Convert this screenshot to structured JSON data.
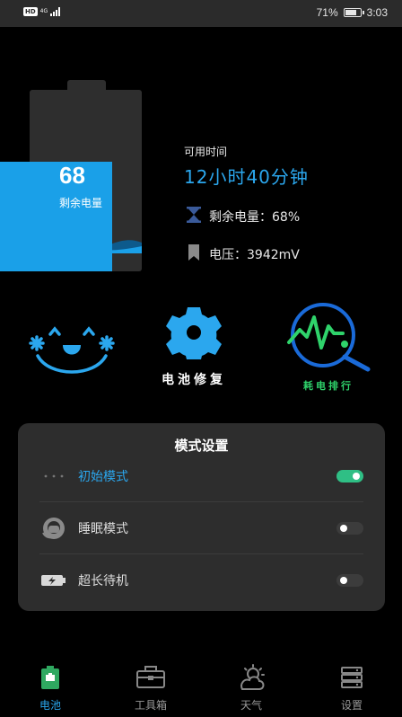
{
  "status_bar": {
    "hd": "HD",
    "network": "4G",
    "battery_percent": "71%",
    "time": "3:03"
  },
  "battery": {
    "level": "68",
    "remaining_label": "剩余电量",
    "level_fraction": 0.68,
    "fill_color": "#1aa0e8"
  },
  "info": {
    "available_label": "可用时间",
    "available_time": "12小时40分钟",
    "remaining_text": "剩余电量：68%",
    "voltage_text": "电压：3942mV",
    "icons": [
      "hourglass-icon",
      "bookmark-icon"
    ]
  },
  "features": [
    {
      "label": "",
      "icon": "happy-face-icon"
    },
    {
      "label": "电池修复",
      "icon": "gear-icon"
    },
    {
      "label": "耗电排行",
      "icon": "heartbeat-magnifier-icon"
    }
  ],
  "mode_panel": {
    "title": "模式设置",
    "modes": [
      {
        "label": "初始模式",
        "icon": "dots-icon",
        "on": true
      },
      {
        "label": "睡眠模式",
        "icon": "headset-icon",
        "on": false
      },
      {
        "label": "超长待机",
        "icon": "battery-charge-icon",
        "on": false
      }
    ]
  },
  "nav": {
    "items": [
      {
        "label": "电池",
        "icon": "battery-icon",
        "active": true
      },
      {
        "label": "工具箱",
        "icon": "toolbox-icon",
        "active": false
      },
      {
        "label": "天气",
        "icon": "weather-icon",
        "active": false
      },
      {
        "label": "设置",
        "icon": "settings-icon",
        "active": false
      }
    ]
  },
  "colors": {
    "accent": "#2ba7ee",
    "green": "#2fd36b",
    "panel": "#2d2d2d"
  }
}
